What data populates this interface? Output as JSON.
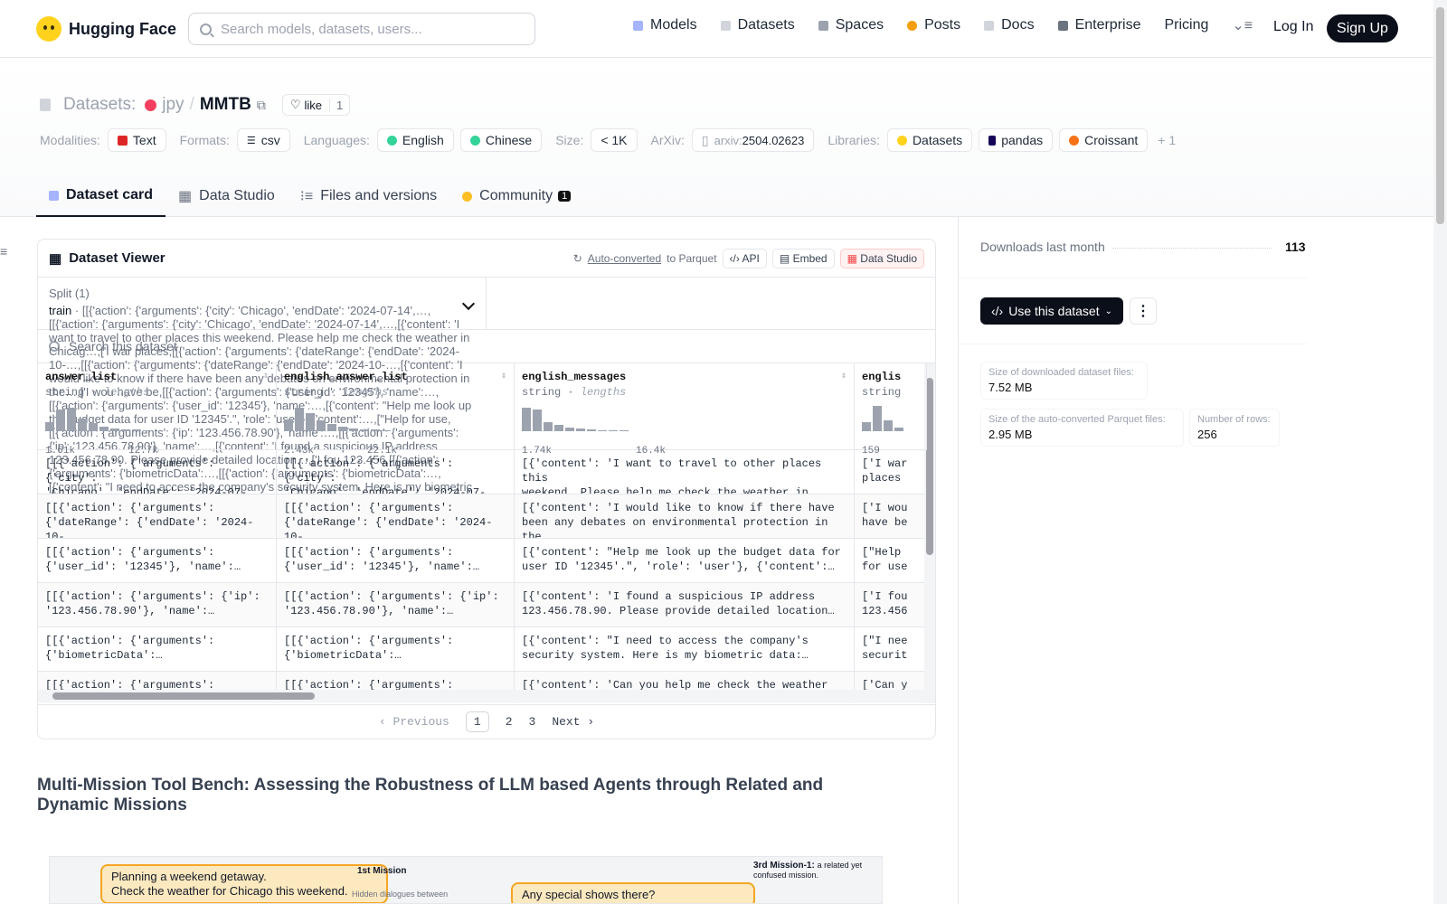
{
  "nav": {
    "brand": "Hugging Face",
    "search_placeholder": "Search models, datasets, users...",
    "menu": [
      {
        "label": "Models",
        "color": "#a5b4fc"
      },
      {
        "label": "Datasets",
        "color": "#d1d5db"
      },
      {
        "label": "Spaces",
        "color": "#9ca3af"
      },
      {
        "label": "Posts",
        "color": "#f59e0b"
      },
      {
        "label": "Docs",
        "color": "#d1d5db"
      },
      {
        "label": "Enterprise",
        "color": "#6b7280"
      },
      {
        "label": "Pricing"
      }
    ],
    "login": "Log In",
    "signup": "Sign Up"
  },
  "repo": {
    "type": "Datasets:",
    "owner": "jpy",
    "sep": "/",
    "name": "MMTB",
    "like": "like",
    "likes": "1"
  },
  "meta": {
    "modalities_label": "Modalities:",
    "modality": "Text",
    "formats_label": "Formats:",
    "format": "csv",
    "languages_label": "Languages:",
    "lang1": "English",
    "lang2": "Chinese",
    "size_label": "Size:",
    "size": "< 1K",
    "arxiv_label": "ArXiv:",
    "arxiv_prefix": "arxiv:",
    "arxiv_id": "2504.02623",
    "libraries_label": "Libraries:",
    "lib1": "Datasets",
    "lib2": "pandas",
    "lib3": "Croissant",
    "more": "+ 1"
  },
  "tabs": {
    "card": "Dataset card",
    "studio": "Data Studio",
    "files": "Files and versions",
    "community": "Community",
    "community_count": "1"
  },
  "viewer": {
    "title": "Dataset Viewer",
    "auto": "Auto-converted",
    "to": "to Parquet",
    "api": "API",
    "embed": "Embed",
    "studio": "Data Studio",
    "split_label": "Split (1)",
    "split": "train",
    "rows": [
      [
        "[[{'action': {'arguments': {'city':\n'Chicago', 'endDate': '2024-07-14',…",
        "[[{'action': {'arguments': {'city':\n'Chicago', 'endDate': '2024-07-14',…",
        "[{'content': 'I want to travel to other places this\nweekend. Please help me check the weather in Chicag…",
        "['I war\nplaces"
      ],
      [
        "[[{'action': {'arguments':\n{'dateRange': {'endDate': '2024-10-…",
        "[[{'action': {'arguments':\n{'dateRange': {'endDate': '2024-10-…",
        "[{'content': 'I would like to know if there have\nbeen any debates on environmental protection in the…",
        "['I wou\nhave be"
      ],
      [
        "[[{'action': {'arguments':\n{'user_id': '12345'}, 'name':…",
        "[[{'action': {'arguments':\n{'user_id': '12345'}, 'name':…",
        "[{'content': \"Help me look up the budget data for\nuser ID '12345'.\", 'role': 'user'}, {'content':…",
        "[\"Help\nfor use"
      ],
      [
        "[[{'action': {'arguments': {'ip':\n'123.456.78.90'}, 'name':…",
        "[[{'action': {'arguments': {'ip':\n'123.456.78.90'}, 'name':…",
        "[{'content': 'I found a suspicious IP address\n123.456.78.90. Please provide detailed location…",
        "['I fou\n123.456"
      ],
      [
        "[[{'action': {'arguments':\n{'biometricData':…",
        "[[{'action': {'arguments':\n{'biometricData':…",
        "[{'content': \"I need to access the company's\nsecurity system. Here is my biometric data:…",
        "[\"I nee\nsecurit"
      ],
      [
        "[[{'action': {'arguments':",
        "[[{'action': {'arguments':",
        "[{'content': 'Can you help me check the weather in",
        "['Can y"
      ]
    ],
    "search": "Search this dataset",
    "columns": [
      {
        "name": "answer_list",
        "type": "string",
        "sub": "lengths",
        "min": "1.61k",
        "max": "12.7k"
      },
      {
        "name": "english_answer_list",
        "type": "string",
        "sub": "lengths",
        "min": "2.43k",
        "max": "22.1k"
      },
      {
        "name": "english_messages",
        "type": "string",
        "sub": "lengths",
        "min": "1.74k",
        "max": "16.4k"
      },
      {
        "name": "englis",
        "type": "string",
        "sub": "",
        "min": "159",
        "max": ""
      }
    ],
    "pager": {
      "prev": "Previous",
      "p1": "1",
      "p2": "2",
      "p3": "3",
      "next": "Next"
    }
  },
  "sidebar": {
    "downloads_label": "Downloads last month",
    "downloads": "113",
    "use": "Use this dataset",
    "size_dl_label": "Size of downloaded dataset files:",
    "size_dl": "7.52 MB",
    "size_pq_label": "Size of the auto-converted Parquet files:",
    "size_pq": "2.95 MB",
    "nrows_label": "Number of rows:",
    "nrows": "256"
  },
  "doc": {
    "title": "Multi-Mission Tool Bench: Assessing the Robustness of LLM based Agents through Related and Dynamic Missions",
    "fig_b1": "Planning a weekend getaway.\nCheck the weather for Chicago this weekend.",
    "fig_b2": "Any special shows there?",
    "fig_m1": "1st Mission",
    "fig_m1sub": "Hidden dialogues between",
    "fig_m3": "3rd Mission-1:",
    "fig_m3sub": "a related yet confused mission."
  },
  "colors": {
    "brand_yellow": "#ffd21e",
    "signup_bg": "#0b0f19",
    "accent_red": "#ef4444"
  }
}
